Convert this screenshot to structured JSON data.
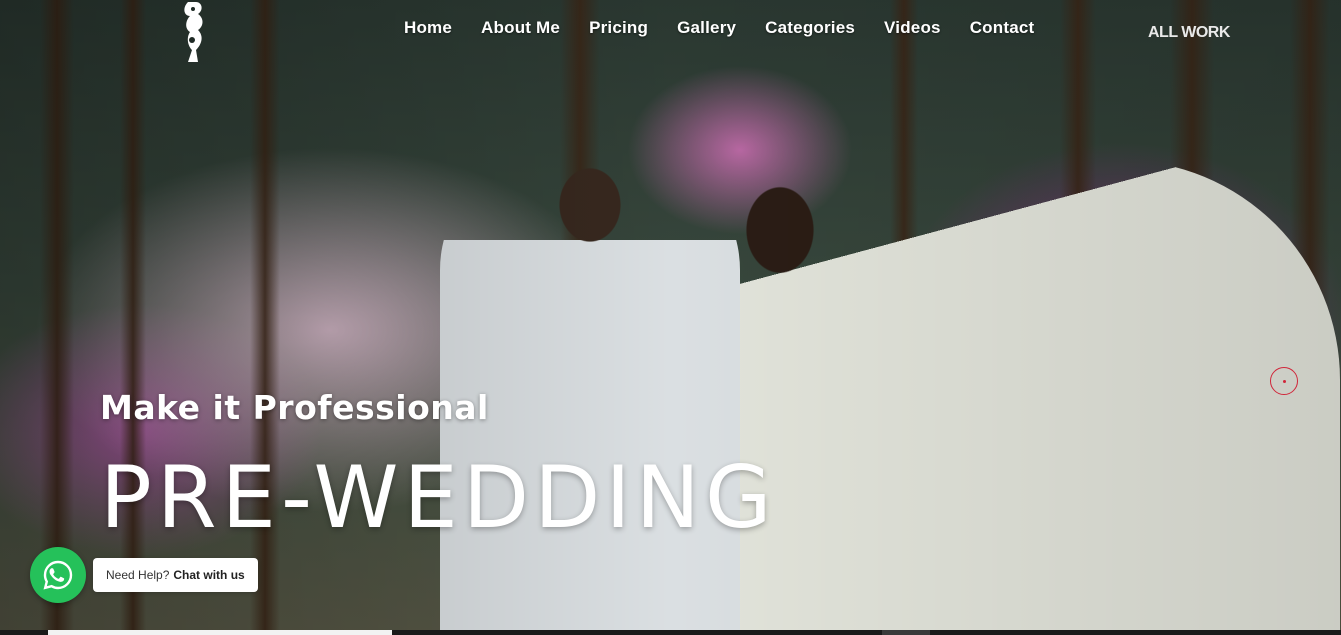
{
  "header": {
    "logo_icon": "ganesha-logo-icon",
    "nav": [
      {
        "label": "Home"
      },
      {
        "label": "About Me"
      },
      {
        "label": "Pricing"
      },
      {
        "label": "Gallery"
      },
      {
        "label": "Categories"
      },
      {
        "label": "Videos"
      },
      {
        "label": "Contact"
      }
    ],
    "all_work": "ALL WORK"
  },
  "hero": {
    "subtitle": "Make it Professional",
    "title": "PRE-WEDDING"
  },
  "whatsapp": {
    "icon": "whatsapp-icon",
    "prefix": "Need Help?",
    "cta": "Chat with us",
    "color": "#25c15a"
  },
  "slider": {
    "accent": "#d0263a"
  }
}
